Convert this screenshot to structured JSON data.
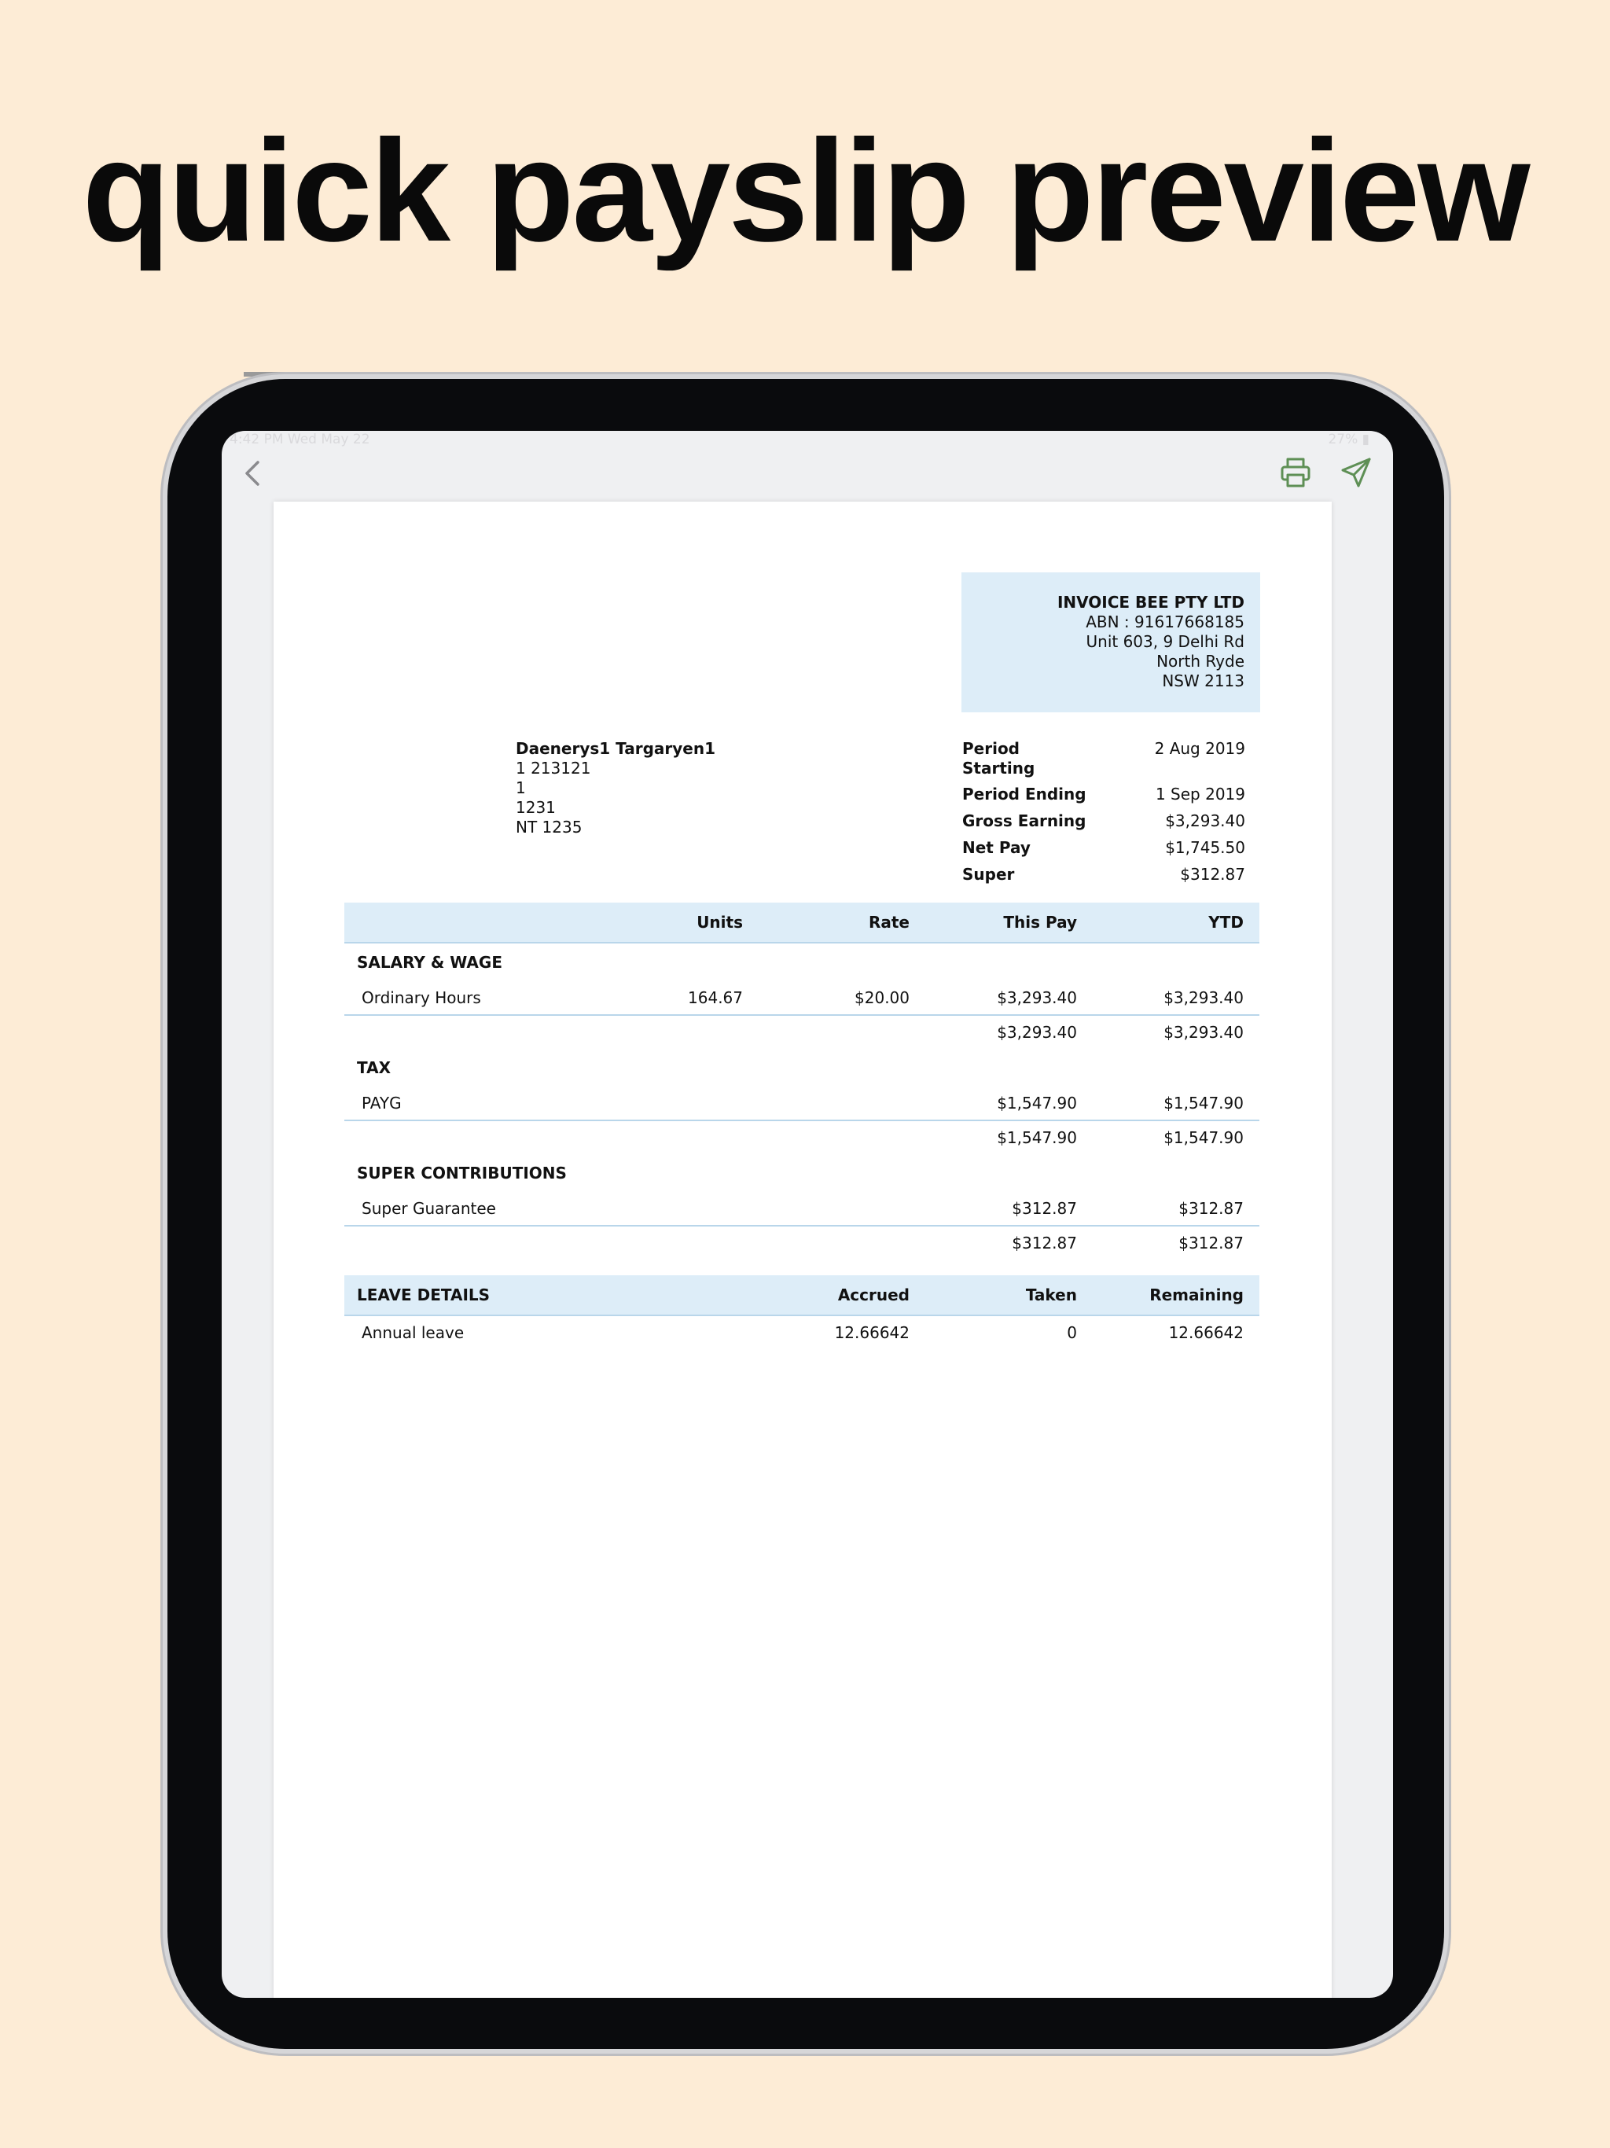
{
  "headline": "quick payslip preview",
  "status_bar": {
    "time": "4:42 PM   Wed May 22",
    "system": "27% ▮"
  },
  "toolbar": {
    "back_icon": "chevron-left-icon",
    "print_icon": "printer-icon",
    "send_icon": "send-icon",
    "accent_color": "#5e8f55"
  },
  "company": {
    "name": "INVOICE BEE PTY LTD",
    "abn": "ABN : 91617668185",
    "address1": "Unit 603, 9 Delhi Rd",
    "address2": "North Ryde",
    "address3": "NSW 2113"
  },
  "employee": {
    "name": "Daenerys1 Targaryen1",
    "line1": "1 213121",
    "line2": "1",
    "line3": "1231",
    "line4": "NT 1235"
  },
  "summary": {
    "period_starting_label": "Period Starting",
    "period_starting": "2 Aug 2019",
    "period_ending_label": "Period Ending",
    "period_ending": "1 Sep 2019",
    "gross_label": "Gross Earning",
    "gross": "$3,293.40",
    "net_label": "Net Pay",
    "net": "$1,745.50",
    "super_label": "Super",
    "super": "$312.87"
  },
  "table": {
    "headers": {
      "units": "Units",
      "rate": "Rate",
      "this_pay": "This Pay",
      "ytd": "YTD"
    },
    "salary": {
      "title": "SALARY & WAGE",
      "item": {
        "label": "Ordinary Hours",
        "units": "164.67",
        "rate": "$20.00",
        "this_pay": "$3,293.40",
        "ytd": "$3,293.40"
      },
      "total": {
        "this_pay": "$3,293.40",
        "ytd": "$3,293.40"
      }
    },
    "tax": {
      "title": "TAX",
      "item": {
        "label": "PAYG",
        "this_pay": "$1,547.90",
        "ytd": "$1,547.90"
      },
      "total": {
        "this_pay": "$1,547.90",
        "ytd": "$1,547.90"
      }
    },
    "super": {
      "title": "SUPER CONTRIBUTIONS",
      "item": {
        "label": "Super Guarantee",
        "this_pay": "$312.87",
        "ytd": "$312.87"
      },
      "total": {
        "this_pay": "$312.87",
        "ytd": "$312.87"
      }
    }
  },
  "leave": {
    "headers": {
      "title": "LEAVE DETAILS",
      "accrued": "Accrued",
      "taken": "Taken",
      "remaining": "Remaining"
    },
    "row": {
      "label": "Annual leave",
      "accrued": "12.66642",
      "taken": "0",
      "remaining": "12.66642"
    }
  }
}
